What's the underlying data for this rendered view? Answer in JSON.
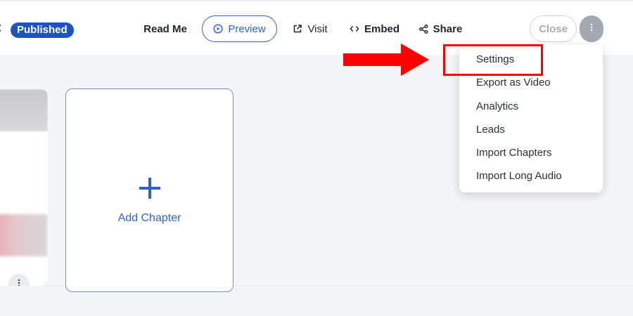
{
  "toolbar": {
    "status_badge": "Published",
    "buttons": {
      "read_me": "Read Me",
      "preview": "Preview",
      "visit": "Visit",
      "embed": "Embed",
      "share": "Share",
      "close": "Close"
    }
  },
  "main": {
    "add_chapter_label": "Add Chapter"
  },
  "dropdown": {
    "items": [
      "Settings",
      "Export as Video",
      "Analytics",
      "Leads",
      "Import Chapters",
      "Import Long Audio"
    ]
  },
  "annotation": {
    "highlight_color": "#ff0000",
    "arrow_color": "#ff0000"
  },
  "colors": {
    "accent": "#2c63d3",
    "badge_bg": "#1c54c7",
    "more_button_bg": "#a3a8b2",
    "canvas_bg": "#f4f5f8"
  },
  "icons": {
    "preview": "play-circle-icon",
    "visit": "external-link-icon",
    "embed": "code-icon",
    "share": "share-icon",
    "more": "vertical-dots-icon",
    "add": "plus-icon"
  }
}
